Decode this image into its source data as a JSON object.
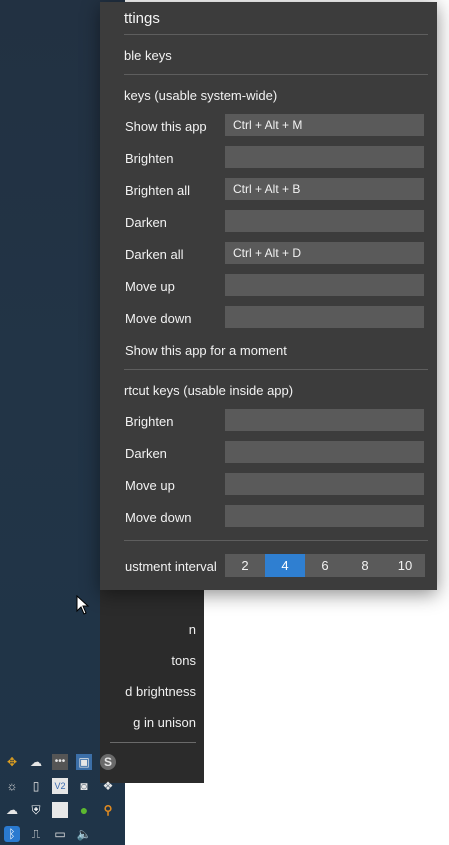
{
  "settings": {
    "title": "ttings",
    "toggle_keys_label": "ble keys",
    "global_section": "keys (usable system-wide)",
    "global_hotkeys": [
      {
        "label": "Show this app",
        "value": "Ctrl + Alt + M"
      },
      {
        "label": "Brighten",
        "value": ""
      },
      {
        "label": "Brighten all",
        "value": "Ctrl + Alt + B"
      },
      {
        "label": "Darken",
        "value": ""
      },
      {
        "label": "Darken all",
        "value": "Ctrl + Alt + D"
      },
      {
        "label": "Move up",
        "value": ""
      },
      {
        "label": "Move down",
        "value": ""
      }
    ],
    "show_moment_label": "Show this app for a moment",
    "app_section": "rtcut keys (usable inside app)",
    "app_hotkeys": [
      {
        "label": "Brighten",
        "value": ""
      },
      {
        "label": "Darken",
        "value": ""
      },
      {
        "label": "Move up",
        "value": ""
      },
      {
        "label": "Move down",
        "value": ""
      }
    ],
    "interval_label": "ustment interval",
    "interval_options": [
      "2",
      "4",
      "6",
      "8",
      "10"
    ],
    "interval_selected": "4"
  },
  "menu": {
    "items": [
      "n",
      "tons",
      "d brightness",
      "g in unison"
    ]
  },
  "taskbar": {
    "tray_icons": [
      "app-icon",
      "cloud-icon",
      "more-icon",
      "photos-icon",
      "skype-icon",
      "sun-icon",
      "speaker-device-icon",
      "vs-icon",
      "camera-icon",
      "dropbox-icon",
      "upload-cloud-icon",
      "shield-icon",
      "blank-app-icon",
      "green-circle-icon",
      "search-icon",
      "bluetooth-icon",
      "usb-icon",
      "network-icon",
      "volume-icon"
    ]
  },
  "colors": {
    "panel_bg": "#3c3c3c",
    "field_bg": "#5a5a5a",
    "accent": "#2f7fd1",
    "menu_bg": "#2b2b2b",
    "desktop_bg": "#223446"
  }
}
